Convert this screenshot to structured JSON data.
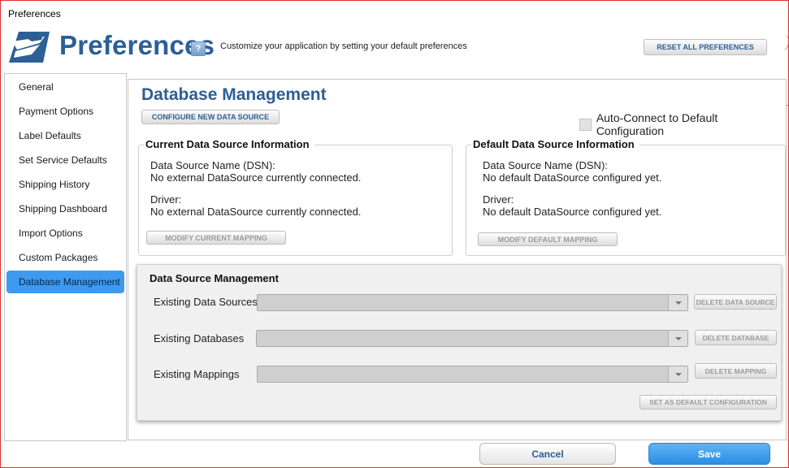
{
  "window": {
    "title": "Preferences"
  },
  "header": {
    "title": "Preferences",
    "subtitle": "Customize your application by setting your default preferences",
    "reset_label": "RESET ALL PREFERENCES",
    "logo_icon": "eagle-logo-icon",
    "help_icon": "help-icon",
    "brand_color": "#2c5f96"
  },
  "sidebar": {
    "items": [
      {
        "label": "General"
      },
      {
        "label": "Payment Options"
      },
      {
        "label": "Label Defaults"
      },
      {
        "label": "Set Service Defaults"
      },
      {
        "label": "Shipping History"
      },
      {
        "label": "Shipping Dashboard"
      },
      {
        "label": "Import Options"
      },
      {
        "label": "Custom Packages"
      },
      {
        "label": "Database Management",
        "active": true
      }
    ],
    "active_color": "#3d9aef"
  },
  "main": {
    "title": "Database Management",
    "configure_label": "CONFIGURE NEW DATA SOURCE",
    "autoconnect_label": "Auto-Connect to Default Configuration",
    "autoconnect_checked": false,
    "current": {
      "title": "Current Data Source Information",
      "dsn_label": "Data Source Name (DSN):",
      "dsn_value": "No external DataSource currently connected.",
      "driver_label": "Driver:",
      "driver_value": "No external DataSource currently connected.",
      "modify_label": "MODIFY CURRENT MAPPING"
    },
    "default": {
      "title": "Default Data Source Information",
      "dsn_label": "Data Source Name (DSN):",
      "dsn_value": "No default DataSource configured yet.",
      "driver_label": "Driver:",
      "driver_value": "No default DataSource configured yet.",
      "modify_label": "MODIFY DEFAULT MAPPING"
    },
    "dsm": {
      "title": "Data Source Management",
      "sources_label": "Existing Data Sources",
      "sources_value": "",
      "delete_source_label": "DELETE DATA SOURCE",
      "databases_label": "Existing Databases",
      "databases_value": "",
      "delete_database_label": "DELETE DATABASE",
      "mappings_label": "Existing Mappings",
      "mappings_value": "",
      "delete_mapping_label": "DELETE MAPPING",
      "set_default_label": "SET AS DEFAULT CONFIGURATION"
    }
  },
  "footer": {
    "cancel_label": "Cancel",
    "save_label": "Save",
    "save_color": "#3d9aef"
  }
}
